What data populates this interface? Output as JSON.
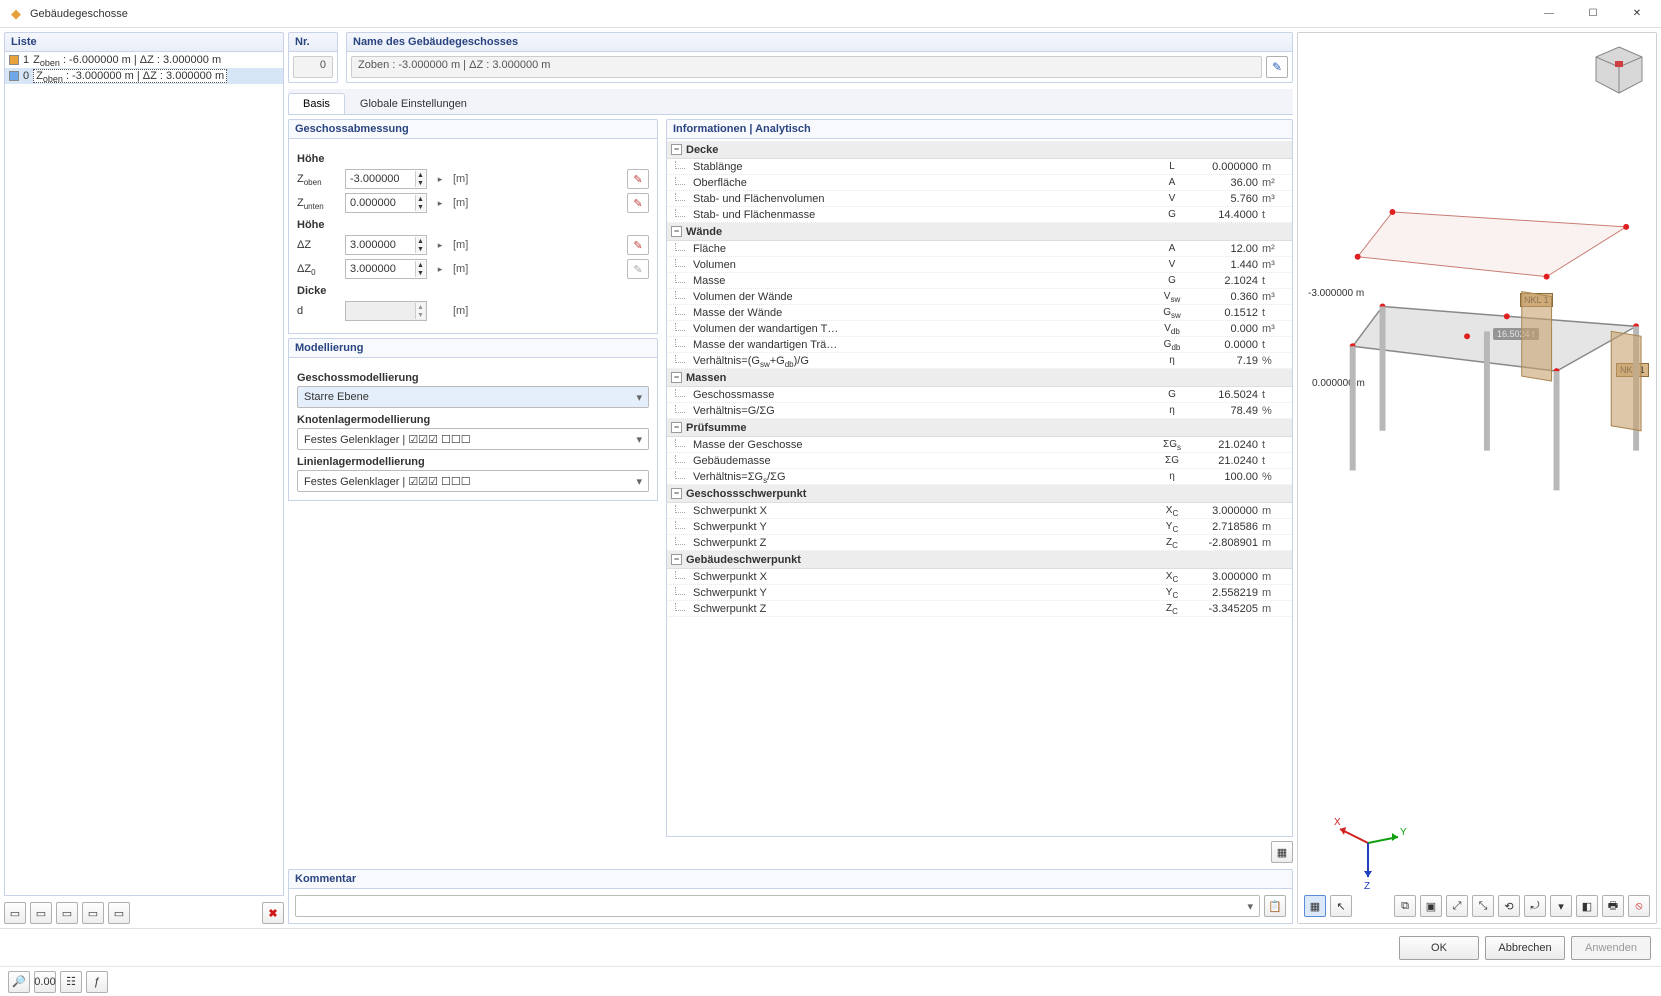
{
  "window": {
    "title": "Gebäudegeschosse"
  },
  "leftPanel": {
    "header": "Liste",
    "rows": [
      {
        "idx": "1",
        "color": "#E8A23B",
        "label": "Z<sub>oben</sub> : -6.000000 m | ΔZ : 3.000000 m"
      },
      {
        "idx": "0",
        "color": "#6EA8E8",
        "label": "Z<sub>oben</sub> : -3.000000 m | ΔZ : 3.000000 m",
        "selected": true
      }
    ]
  },
  "header": {
    "nrLabel": "Nr.",
    "nrValue": "0",
    "nameLabel": "Name des Gebäudegeschosses",
    "nameValue": "Zoben : -3.000000 m | ΔZ : 3.000000 m"
  },
  "tabs": {
    "basis": "Basis",
    "globale": "Globale Einstellungen",
    "active": "basis"
  },
  "geschossabmessung": {
    "title": "Geschossabmessung",
    "hoehe1": "Höhe",
    "zoben": {
      "lbl": "Z<sub>oben</sub>",
      "val": "-3.000000",
      "unit": "[m]"
    },
    "zunten": {
      "lbl": "Z<sub>unten</sub>",
      "val": "0.000000",
      "unit": "[m]"
    },
    "hoehe2": "Höhe",
    "dz": {
      "lbl": "ΔZ",
      "val": "3.000000",
      "unit": "[m]"
    },
    "dz0": {
      "lbl": "ΔZ<sub>0</sub>",
      "val": "3.000000",
      "unit": "[m]"
    },
    "dicke": "Dicke",
    "d": {
      "lbl": "d",
      "val": "",
      "unit": "[m]"
    }
  },
  "modellierung": {
    "title": "Modellierung",
    "geschoss": {
      "lbl": "Geschossmodellierung",
      "val": "Starre Ebene"
    },
    "knoten": {
      "lbl": "Knotenlagermodellierung",
      "val": "Festes Gelenklager | ☑☑☑ ☐☐☐"
    },
    "linien": {
      "lbl": "Linienlagermodellierung",
      "val": "Festes Gelenklager | ☑☑☑ ☐☐☐"
    }
  },
  "info": {
    "title": "Informationen | Analytisch",
    "groups": [
      {
        "name": "Decke",
        "rows": [
          {
            "l": "Stablänge",
            "s": "L",
            "v": "0.000000",
            "u": "m"
          },
          {
            "l": "Oberfläche",
            "s": "A",
            "v": "36.00",
            "u": "m²"
          },
          {
            "l": "Stab- und Flächenvolumen",
            "s": "V",
            "v": "5.760",
            "u": "m³"
          },
          {
            "l": "Stab- und Flächenmasse",
            "s": "G",
            "v": "14.4000",
            "u": "t"
          }
        ]
      },
      {
        "name": "Wände",
        "rows": [
          {
            "l": "Fläche",
            "s": "A",
            "v": "12.00",
            "u": "m²"
          },
          {
            "l": "Volumen",
            "s": "V",
            "v": "1.440",
            "u": "m³"
          },
          {
            "l": "Masse",
            "s": "G",
            "v": "2.1024",
            "u": "t"
          },
          {
            "l": "Volumen der Wände",
            "s": "V<sub>sw</sub>",
            "v": "0.360",
            "u": "m³"
          },
          {
            "l": "Masse der Wände",
            "s": "G<sub>sw</sub>",
            "v": "0.1512",
            "u": "t"
          },
          {
            "l": "Volumen der wandartigen T…",
            "s": "V<sub>db</sub>",
            "v": "0.000",
            "u": "m³"
          },
          {
            "l": "Masse der wandartigen Trä…",
            "s": "G<sub>db</sub>",
            "v": "0.0000",
            "u": "t"
          },
          {
            "l": "Verhältnis=(G<sub>sw</sub>+G<sub>db</sub>)/G",
            "s": "η",
            "v": "7.19",
            "u": "%"
          }
        ]
      },
      {
        "name": "Massen",
        "rows": [
          {
            "l": "Geschossmasse",
            "s": "G",
            "v": "16.5024",
            "u": "t"
          },
          {
            "l": "Verhältnis=G/ΣG",
            "s": "η",
            "v": "78.49",
            "u": "%"
          }
        ]
      },
      {
        "name": "Prüfsumme",
        "rows": [
          {
            "l": "Masse der Geschosse",
            "s": "ΣG<sub>s</sub>",
            "v": "21.0240",
            "u": "t"
          },
          {
            "l": "Gebäudemasse",
            "s": "ΣG",
            "v": "21.0240",
            "u": "t"
          },
          {
            "l": "Verhältnis=ΣG<sub>s</sub>/ΣG",
            "s": "η",
            "v": "100.00",
            "u": "%"
          }
        ]
      },
      {
        "name": "Geschossschwerpunkt",
        "rows": [
          {
            "l": "Schwerpunkt X",
            "s": "X<sub>C</sub>",
            "v": "3.000000",
            "u": "m"
          },
          {
            "l": "Schwerpunkt Y",
            "s": "Y<sub>C</sub>",
            "v": "2.718586",
            "u": "m"
          },
          {
            "l": "Schwerpunkt Z",
            "s": "Z<sub>C</sub>",
            "v": "-2.808901",
            "u": "m"
          }
        ]
      },
      {
        "name": "Gebäudeschwerpunkt",
        "rows": [
          {
            "l": "Schwerpunkt X",
            "s": "X<sub>C</sub>",
            "v": "3.000000",
            "u": "m"
          },
          {
            "l": "Schwerpunkt Y",
            "s": "Y<sub>C</sub>",
            "v": "2.558219",
            "u": "m"
          },
          {
            "l": "Schwerpunkt Z",
            "s": "Z<sub>C</sub>",
            "v": "-3.345205",
            "u": "m"
          }
        ]
      }
    ]
  },
  "kommentar": {
    "title": "Kommentar",
    "value": ""
  },
  "viewport": {
    "topLevel": "-3.000000 m",
    "bottomLevel": "0.000000 m",
    "massLabel": "16.5024 t",
    "nkl": "NKL 1",
    "axes": {
      "x": "X",
      "y": "Y",
      "z": "Z"
    }
  },
  "buttons": {
    "ok": "OK",
    "cancel": "Abbrechen",
    "apply": "Anwenden"
  }
}
